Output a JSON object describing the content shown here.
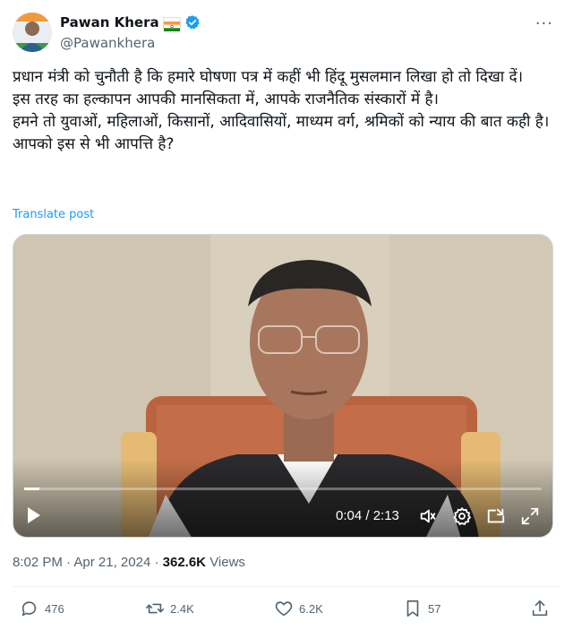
{
  "author": {
    "display_name": "Pawan Khera",
    "handle": "@Pawankhera",
    "flag_icon": "india-flag-icon",
    "verified_icon": "verified-badge-icon",
    "verified_color": "#1d9bf0"
  },
  "tweet": {
    "lines": [
      "प्रधान मंत्री को चुनौती है कि हमारे घोषणा पत्र में कहीं भी हिंदू मुसलमान लिखा हो तो दिखा दें।",
      "इस तरह का हल्कापन आपकी मानसिकता में, आपके राजनैतिक संस्कारों में है।",
      "हमने तो युवाओं, महिलाओं, किसानों, आदिवासियों, माध्यम वर्ग, श्रमिकों को न्याय की बात कही है।",
      "आपको इस से भी आपत्ति है?"
    ],
    "translate_label": "Translate post"
  },
  "video": {
    "time_display": "0:04 / 2:13",
    "progress": 0.03
  },
  "meta": {
    "time": "8:02 PM",
    "separator": "·",
    "date": "Apr 21, 2024",
    "views_count": "362.6K",
    "views_label": "Views"
  },
  "actions": {
    "replies": "476",
    "reposts": "2.4K",
    "likes": "6.2K",
    "bookmarks": "57"
  }
}
